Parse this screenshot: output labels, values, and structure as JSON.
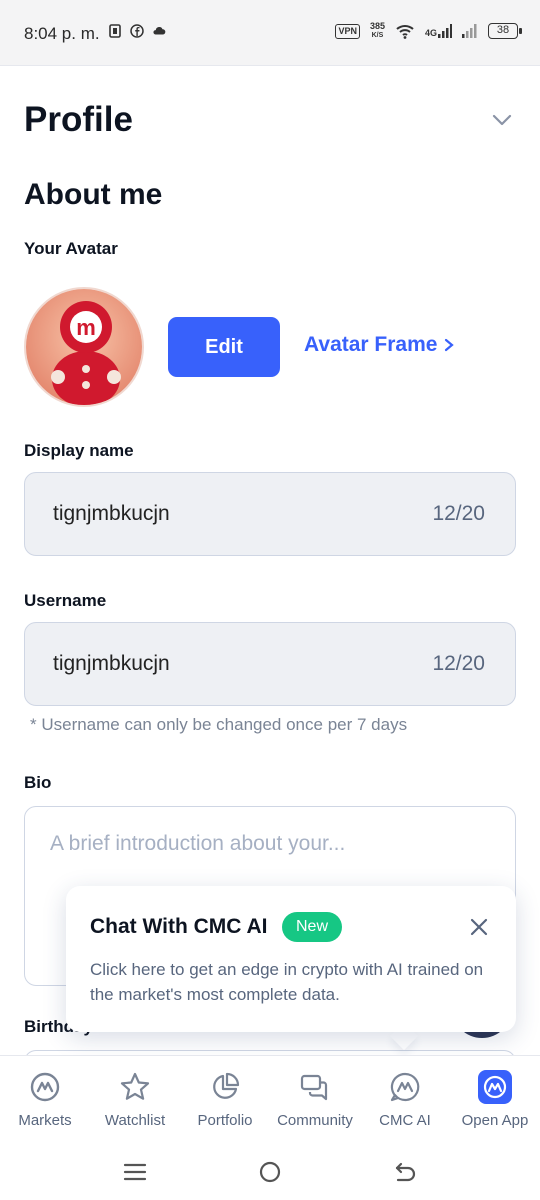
{
  "status_bar": {
    "time": "8:04 p. m.",
    "vpn": "VPN",
    "speed_value": "385",
    "speed_unit": "K/S",
    "network": "4G",
    "battery": "38"
  },
  "header": {
    "title": "Profile"
  },
  "about": {
    "title": "About me",
    "avatar_label": "Your Avatar",
    "edit_label": "Edit",
    "frame_label": "Avatar Frame"
  },
  "display_name": {
    "label": "Display name",
    "value": "tignjmbkucjn",
    "count": "12/20"
  },
  "username": {
    "label": "Username",
    "value": "tignjmbkucjn",
    "count": "12/20",
    "hint": "* Username can only be changed once per 7 days"
  },
  "bio": {
    "label": "Bio",
    "placeholder": "A brief introduction about your..."
  },
  "birthday": {
    "label": "Birthday"
  },
  "tooltip": {
    "title": "Chat With CMC AI",
    "badge": "New",
    "body": "Click here to get an edge in crypto with AI trained on the market's most complete data."
  },
  "nav": {
    "markets": "Markets",
    "watchlist": "Watchlist",
    "portfolio": "Portfolio",
    "community": "Community",
    "cmc_ai": "CMC AI",
    "open_app": "Open App"
  },
  "colors": {
    "accent": "#3861fb",
    "badge": "#16c784",
    "text": "#0d1421",
    "muted": "#58667e"
  }
}
